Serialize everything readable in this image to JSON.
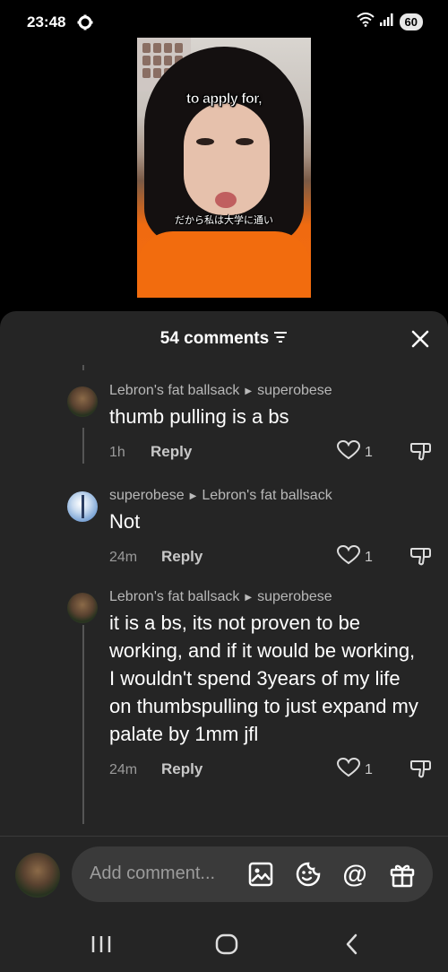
{
  "status_bar": {
    "time": "23:48",
    "battery": "60"
  },
  "video": {
    "caption_en": "to apply for,",
    "caption_jp": "だから私は大学に通い"
  },
  "comments_panel": {
    "title": "54 comments",
    "comments": [
      {
        "author": "Lebron's fat ballsack",
        "reply_to": "superobese",
        "text": "thumb pulling is a bs",
        "age": "1h",
        "reply_label": "Reply",
        "likes": "1"
      },
      {
        "author": "superobese",
        "reply_to": "Lebron's fat ballsack",
        "text": "Not",
        "age": "24m",
        "reply_label": "Reply",
        "likes": "1"
      },
      {
        "author": "Lebron's fat ballsack",
        "reply_to": "superobese",
        "text": "it is a bs, its not proven to be working, and if it would be working, I wouldn't spend 3years of my life on thumbspulling to just expand my palate by 1mm jfl",
        "age": "24m",
        "reply_label": "Reply",
        "likes": "1"
      }
    ]
  },
  "composer": {
    "placeholder": "Add comment..."
  },
  "icons": [
    "gear-icon",
    "wifi-icon",
    "signal-icon",
    "filter-icon",
    "close-icon",
    "heart-icon",
    "dislike-icon",
    "image-icon",
    "emoji-icon",
    "at-icon",
    "gift-icon",
    "recents-icon",
    "home-icon",
    "back-icon"
  ]
}
